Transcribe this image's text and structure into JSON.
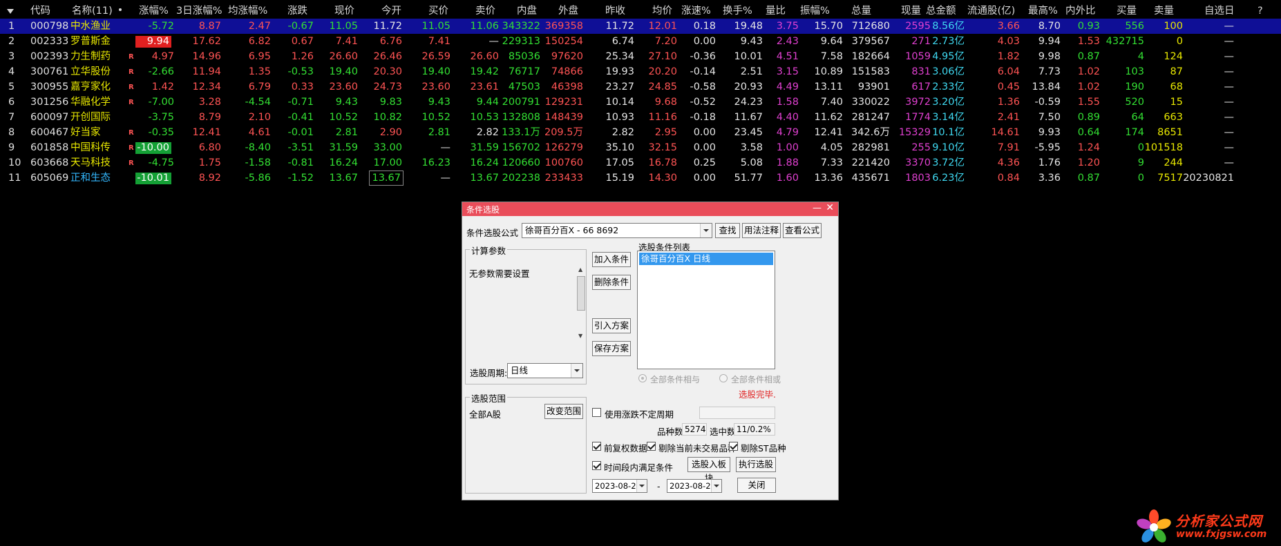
{
  "table": {
    "headers": [
      "代码",
      "名称(11)",
      "涨幅%",
      "3日涨幅%",
      "均涨幅%",
      "涨跌",
      "现价",
      "今开",
      "买价",
      "卖价",
      "内盘",
      "外盘",
      "昨收",
      "均价",
      "涨速%",
      "换手%",
      "量比",
      "振幅%",
      "总量",
      "现量",
      "总金额",
      "流通股(亿)",
      "最高%",
      "内外比",
      "买量",
      "卖量",
      "自选日",
      "?"
    ],
    "rows": [
      [
        "1",
        "000798",
        "中水渔业",
        "-5.72",
        "8.87",
        "2.47",
        "-0.67",
        "11.05",
        "11.72",
        "11.05",
        "11.06",
        "343322",
        "369358",
        "11.72",
        "12.01",
        "0.18",
        "19.48",
        "3.75",
        "15.70",
        "712680",
        "2595",
        "8.56亿",
        "3.66",
        "8.70",
        "0.93",
        "556",
        "100",
        "—"
      ],
      [
        "2",
        "002333",
        "罗普斯金",
        "9.94",
        "17.62",
        "6.82",
        "0.67",
        "7.41",
        "6.76",
        "7.41",
        "—",
        "229313",
        "150254",
        "6.74",
        "7.20",
        "0.00",
        "9.43",
        "2.43",
        "9.64",
        "379567",
        "271",
        "2.73亿",
        "4.03",
        "9.94",
        "1.53",
        "432715",
        "0",
        "—"
      ],
      [
        "3",
        "002393",
        "力生制药",
        "4.97",
        "14.96",
        "6.95",
        "1.26",
        "26.60",
        "26.46",
        "26.59",
        "26.60",
        "85036",
        "97620",
        "25.34",
        "27.10",
        "-0.36",
        "10.01",
        "4.51",
        "7.58",
        "182664",
        "1059",
        "4.95亿",
        "1.82",
        "9.98",
        "0.87",
        "4",
        "124",
        "—"
      ],
      [
        "4",
        "300761",
        "立华股份",
        "-2.66",
        "11.94",
        "1.35",
        "-0.53",
        "19.40",
        "20.30",
        "19.40",
        "19.42",
        "76717",
        "74866",
        "19.93",
        "20.20",
        "-0.14",
        "2.51",
        "3.15",
        "10.89",
        "151583",
        "831",
        "3.06亿",
        "6.04",
        "7.73",
        "1.02",
        "103",
        "87",
        "—"
      ],
      [
        "5",
        "300955",
        "嘉亨家化",
        "1.42",
        "12.34",
        "6.79",
        "0.33",
        "23.60",
        "24.73",
        "23.60",
        "23.61",
        "47503",
        "46398",
        "23.27",
        "24.85",
        "-0.58",
        "20.93",
        "4.49",
        "13.11",
        "93901",
        "617",
        "2.33亿",
        "0.45",
        "13.84",
        "1.02",
        "190",
        "68",
        "—"
      ],
      [
        "6",
        "301256",
        "华融化学",
        "-7.00",
        "3.28",
        "-4.54",
        "-0.71",
        "9.43",
        "9.83",
        "9.43",
        "9.44",
        "200791",
        "129231",
        "10.14",
        "9.68",
        "-0.52",
        "24.23",
        "1.58",
        "7.40",
        "330022",
        "3972",
        "3.20亿",
        "1.36",
        "-0.59",
        "1.55",
        "520",
        "15",
        "—"
      ],
      [
        "7",
        "600097",
        "开创国际",
        "-3.75",
        "8.79",
        "2.10",
        "-0.41",
        "10.52",
        "10.82",
        "10.52",
        "10.53",
        "132808",
        "148439",
        "10.93",
        "11.16",
        "-0.18",
        "11.67",
        "4.40",
        "11.62",
        "281247",
        "1774",
        "3.14亿",
        "2.41",
        "7.50",
        "0.89",
        "64",
        "663",
        "—"
      ],
      [
        "8",
        "600467",
        "好当家",
        "-0.35",
        "12.41",
        "4.61",
        "-0.01",
        "2.81",
        "2.90",
        "2.81",
        "2.82",
        "133.1万",
        "209.5万",
        "2.82",
        "2.95",
        "0.00",
        "23.45",
        "4.79",
        "12.41",
        "342.6万",
        "15329",
        "10.1亿",
        "14.61",
        "9.93",
        "0.64",
        "174",
        "8651",
        "—"
      ],
      [
        "9",
        "601858",
        "中国科传",
        "-10.00",
        "6.80",
        "-8.40",
        "-3.51",
        "31.59",
        "33.00",
        "—",
        "31.59",
        "156702",
        "126279",
        "35.10",
        "32.15",
        "0.00",
        "3.58",
        "1.00",
        "4.05",
        "282981",
        "255",
        "9.10亿",
        "7.91",
        "-5.95",
        "1.24",
        "0",
        "101518",
        "—"
      ],
      [
        "10",
        "603668",
        "天马科技",
        "-4.75",
        "1.75",
        "-1.58",
        "-0.81",
        "16.24",
        "17.00",
        "16.23",
        "16.24",
        "120660",
        "100760",
        "17.05",
        "16.78",
        "0.25",
        "5.08",
        "1.88",
        "7.33",
        "221420",
        "3370",
        "3.72亿",
        "4.36",
        "1.76",
        "1.20",
        "9",
        "244",
        "—"
      ],
      [
        "11",
        "605069",
        "正和生态",
        "-10.01",
        "8.92",
        "-5.86",
        "-1.52",
        "13.67",
        "13.67",
        "—",
        "13.67",
        "202238",
        "233433",
        "15.19",
        "14.30",
        "0.00",
        "51.77",
        "1.60",
        "13.36",
        "435671",
        "1803",
        "6.23亿",
        "0.84",
        "3.36",
        "0.87",
        "0",
        "7517",
        "20230821"
      ]
    ],
    "r_marks": [
      "",
      "",
      "R",
      "R",
      "R",
      "R",
      "",
      "R",
      "R",
      "R",
      ""
    ],
    "colors": {
      "red": "#ff5454",
      "green": "#33e033",
      "yellow": "#e8e800",
      "cyan": "#3fd8f0",
      "magenta": "#e040d0",
      "selected_row": "#0f0f96"
    }
  },
  "dialog": {
    "title": "条件选股",
    "formula_label": "条件选股公式",
    "formula_value": "徐哥百分百X  -  66  8692",
    "btn_find": "查找",
    "btn_usage": "用法注释",
    "btn_view_formula": "查看公式",
    "params_group": "计算参数",
    "params_text": "无参数需要设置",
    "period_label": "选股周期:",
    "period_value": "日线",
    "btn_add": "加入条件",
    "btn_delete": "删除条件",
    "btn_import": "引入方案",
    "btn_save": "保存方案",
    "list_label": "选股条件列表",
    "list_items": [
      "徐哥百分百X  日线"
    ],
    "radio_and": "全部条件相与",
    "radio_or": "全部条件相或",
    "status": "选股完毕.",
    "range_group": "选股范围",
    "range_value": "全部A股",
    "btn_change_range": "改变范围",
    "chk_uncertain_period": "使用涨跌不定周期",
    "count_label": "品种数",
    "count_value": "5274",
    "selected_label": "选中数",
    "selected_value": "11/0.2%",
    "chk_forward_adjust": "前复权数据",
    "chk_exclude_untraded": "剔除当前未交易品种",
    "chk_exclude_st": "剔除ST品种",
    "chk_time_range": "时间段内满足条件",
    "btn_to_block": "选股入板块",
    "btn_execute": "执行选股",
    "date_from": "2023-08-24",
    "date_sep": "-",
    "date_to": "2023-08-24",
    "btn_close": "关闭"
  },
  "watermark": {
    "line1": "分析家公式网",
    "line2": "www.fxjgsw.com"
  }
}
